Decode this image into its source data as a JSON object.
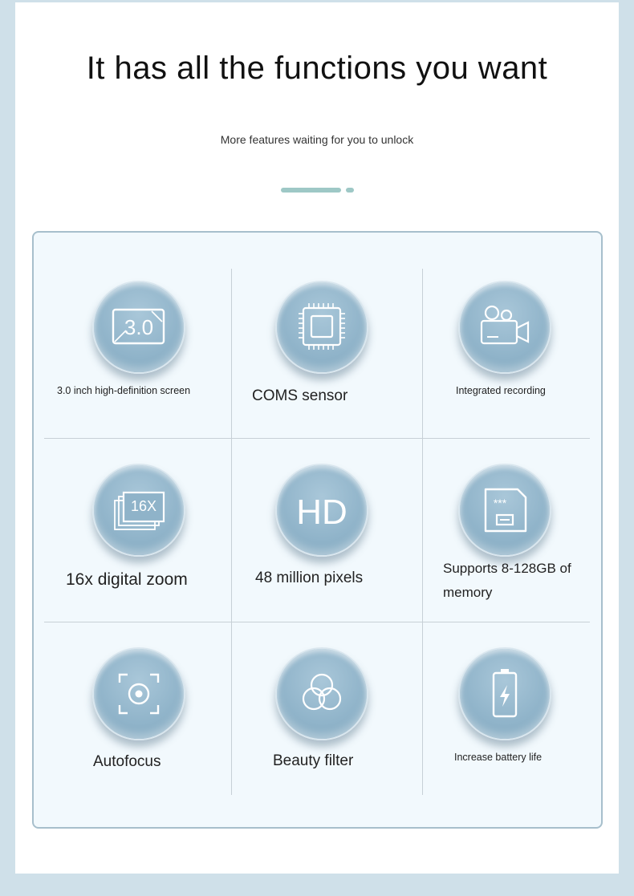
{
  "header": {
    "title": "It has all the functions you want",
    "subtitle": "More features waiting for you to unlock"
  },
  "features": [
    {
      "label": "3.0 inch high-definition screen",
      "icon": "screen-3-0-icon",
      "icon_text": "3.0"
    },
    {
      "label": "COMS sensor",
      "icon": "chip-sensor-icon"
    },
    {
      "label": "Integrated recording",
      "icon": "video-camera-icon"
    },
    {
      "label": "16x digital zoom",
      "icon": "zoom-16x-icon",
      "icon_text": "16X"
    },
    {
      "label": "48 million pixels",
      "icon": "hd-icon",
      "icon_text": "HD"
    },
    {
      "label": "Supports 8-128GB of memory",
      "icon": "memory-card-icon",
      "icon_text": "***"
    },
    {
      "label": "Autofocus",
      "icon": "focus-icon"
    },
    {
      "label": "Beauty filter",
      "icon": "filter-circles-icon"
    },
    {
      "label": "Increase battery life",
      "icon": "battery-icon"
    }
  ],
  "colors": {
    "background": "#cfe0e9",
    "card_background": "#f2f9fd",
    "card_border": "#a7bfcc",
    "accent_dash": "#9ec8c6",
    "icon_circle": "#8fb3c9"
  }
}
